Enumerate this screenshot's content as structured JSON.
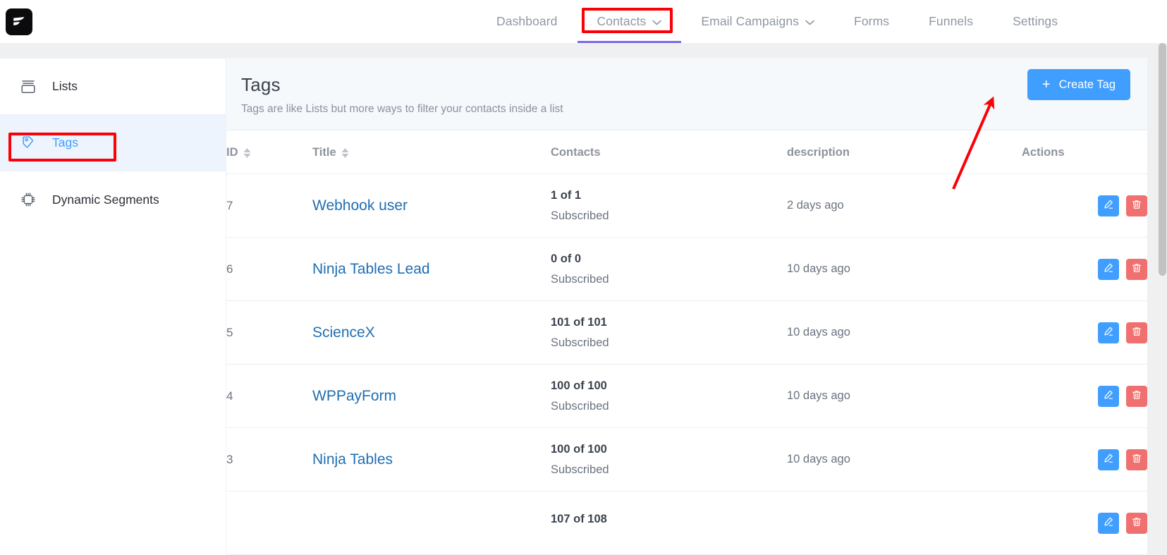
{
  "app": {
    "logo_icon": "fluentcrm-logo-icon",
    "accent_color": "#409eff",
    "nav_active_underline_color": "#7b68ee",
    "annotation_color": "#fb0007",
    "link_color": "#1f6eb2",
    "delete_color": "#f07070"
  },
  "topnav": {
    "items": [
      {
        "label": "Dashboard",
        "has_caret": false,
        "active": false
      },
      {
        "label": "Contacts",
        "has_caret": true,
        "active": true
      },
      {
        "label": "Email Campaigns",
        "has_caret": true,
        "active": false
      },
      {
        "label": "Forms",
        "has_caret": false,
        "active": false
      },
      {
        "label": "Funnels",
        "has_caret": false,
        "active": false
      },
      {
        "label": "Settings",
        "has_caret": false,
        "active": false
      }
    ]
  },
  "sidebar": {
    "items": [
      {
        "label": "Lists",
        "icon": "archive-box-icon",
        "active": false
      },
      {
        "label": "Tags",
        "icon": "tag-icon",
        "active": true
      },
      {
        "label": "Dynamic Segments",
        "icon": "chip-icon",
        "active": false
      }
    ]
  },
  "main": {
    "title": "Tags",
    "subtitle": "Tags are like Lists but more ways to filter your contacts inside a list",
    "create_button": {
      "label": "Create Tag",
      "icon": "plus-icon"
    }
  },
  "table": {
    "columns": [
      {
        "key": "id",
        "label": "ID",
        "sortable": true
      },
      {
        "key": "title",
        "label": "Title",
        "sortable": true
      },
      {
        "key": "contacts",
        "label": "Contacts",
        "sortable": false
      },
      {
        "key": "description",
        "label": "description",
        "sortable": false
      },
      {
        "key": "actions",
        "label": "Actions",
        "sortable": false
      }
    ],
    "rows": [
      {
        "id": "7",
        "title": "Webhook user",
        "count": "1 of 1",
        "status": "Subscribed",
        "description": "2 days ago"
      },
      {
        "id": "6",
        "title": "Ninja Tables Lead",
        "count": "0 of 0",
        "status": "Subscribed",
        "description": "10 days ago"
      },
      {
        "id": "5",
        "title": "ScienceX",
        "count": "101 of 101",
        "status": "Subscribed",
        "description": "10 days ago"
      },
      {
        "id": "4",
        "title": "WPPayForm",
        "count": "100 of 100",
        "status": "Subscribed",
        "description": "10 days ago"
      },
      {
        "id": "3",
        "title": "Ninja Tables",
        "count": "100 of 100",
        "status": "Subscribed",
        "description": "10 days ago"
      },
      {
        "id": "",
        "title": "",
        "count": "107 of 108",
        "status": "",
        "description": ""
      }
    ],
    "row_actions": {
      "edit": {
        "icon": "pencil-icon",
        "label": "Edit"
      },
      "delete": {
        "icon": "trash-icon",
        "label": "Delete"
      }
    }
  },
  "annotations": [
    {
      "name": "contacts-nav-highlight",
      "shape": "rect"
    },
    {
      "name": "tags-sidebar-highlight",
      "shape": "rect"
    },
    {
      "name": "create-tag-pointer",
      "shape": "arrow"
    }
  ]
}
